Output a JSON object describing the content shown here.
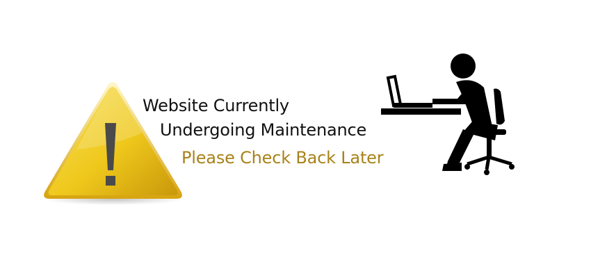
{
  "message": {
    "line1": "Website Currently",
    "line2": "Undergoing Maintenance",
    "line3": "Please Check Back Later"
  },
  "colors": {
    "text_primary": "#111111",
    "text_accent": "#a8831a",
    "sign_yellow": "#f2cc1a",
    "sign_gold": "#c79a0a",
    "figure_black": "#000000"
  },
  "icons": {
    "warning": "warning-triangle-icon",
    "figure": "person-at-laptop-icon"
  }
}
